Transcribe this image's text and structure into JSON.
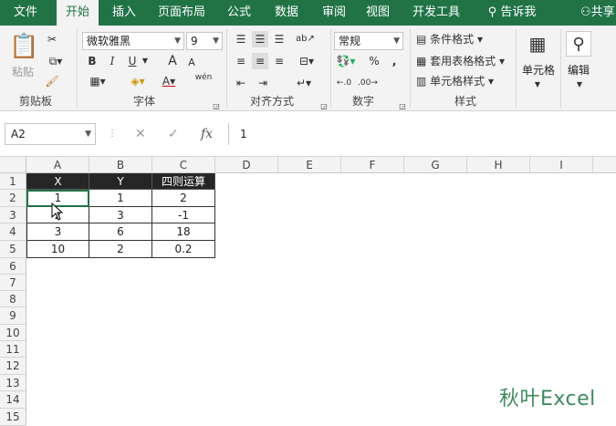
{
  "tabs": [
    "文件",
    "开始",
    "插入",
    "页面布局",
    "公式",
    "数据",
    "审阅",
    "视图",
    "开发工具"
  ],
  "tell_me": "告诉我",
  "share": "共享",
  "ribbon": {
    "clipboard": {
      "paste": "粘贴",
      "group": "剪贴板"
    },
    "font": {
      "name": "微软雅黑",
      "size": "9",
      "bold": "B",
      "italic": "I",
      "underline": "U",
      "grow": "A",
      "shrink": "A",
      "wen": "wén",
      "group": "字体"
    },
    "align": {
      "group": "对齐方式"
    },
    "number": {
      "format": "常规",
      "percent": "%",
      "comma": ",",
      "group": "数字"
    },
    "styles": {
      "conditional": "条件格式",
      "table": "套用表格格式",
      "cell_styles": "单元格样式",
      "group": "样式"
    },
    "cells": {
      "label": "单元格"
    },
    "editing": {
      "label": "编辑"
    }
  },
  "formula_bar": {
    "name_box": "A2",
    "fx": "fx",
    "value": "1"
  },
  "columns": [
    "A",
    "B",
    "C",
    "D",
    "E",
    "F",
    "G",
    "H",
    "I"
  ],
  "rows": [
    "1",
    "2",
    "3",
    "4",
    "5",
    "6",
    "7",
    "8",
    "9",
    "10",
    "11",
    "12",
    "13",
    "14",
    "15"
  ],
  "table": {
    "headers": [
      "X",
      "Y",
      "四则运算"
    ],
    "rows": [
      [
        "1",
        "1",
        "2"
      ],
      [
        "2",
        "3",
        "-1"
      ],
      [
        "3",
        "6",
        "18"
      ],
      [
        "10",
        "2",
        "0.2"
      ]
    ]
  },
  "watermark": "秋叶Excel",
  "colors": {
    "brand": "#217346",
    "header_fill": "#262626"
  }
}
